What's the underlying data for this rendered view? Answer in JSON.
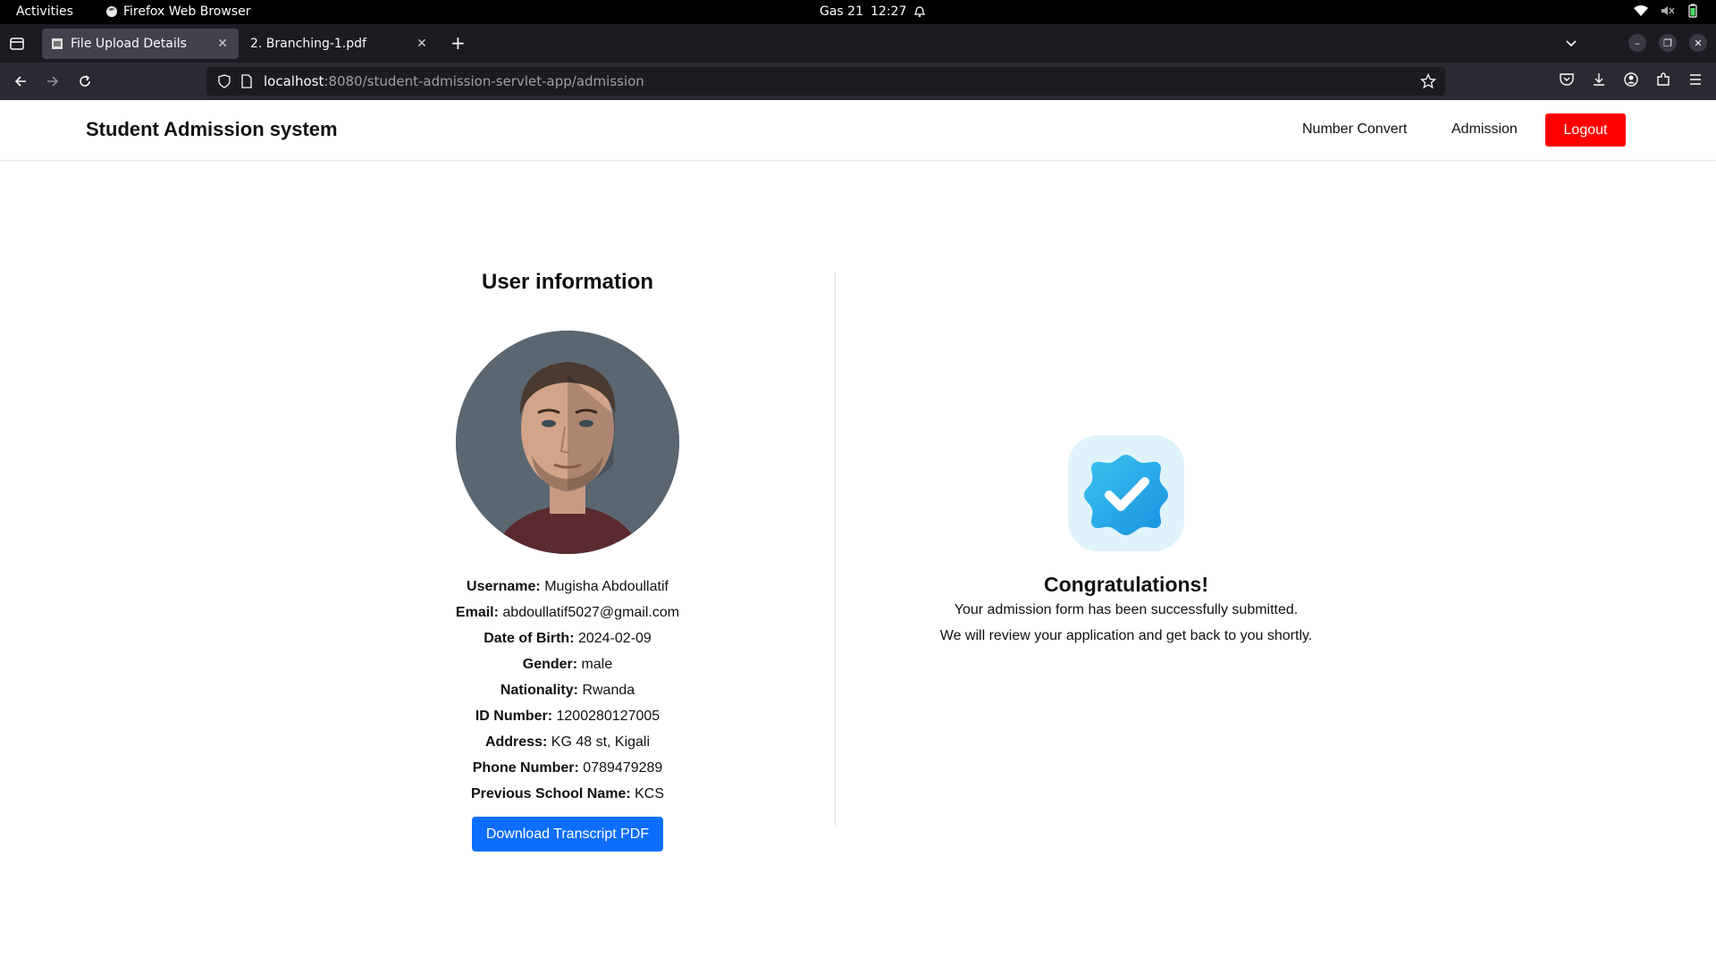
{
  "os_topbar": {
    "activities": "Activities",
    "app_name": "Firefox Web Browser",
    "clock_day": "Gas 21",
    "clock_time": "12:27"
  },
  "browser": {
    "tabs": [
      {
        "label": "File Upload Details",
        "active": true
      },
      {
        "label": "2. Branching-1.pdf",
        "active": false
      }
    ],
    "url_host": "localhost",
    "url_path": ":8080/student-admission-servlet-app/admission"
  },
  "site": {
    "brand": "Student Admission system",
    "nav": {
      "number_convert": "Number Convert",
      "admission": "Admission",
      "logout": "Logout"
    },
    "logout_color": "#ff0000"
  },
  "user_info": {
    "title": "User information",
    "fields": [
      {
        "label": "Username:",
        "value": "Mugisha Abdoullatif"
      },
      {
        "label": "Email:",
        "value": "abdoullatif5027@gmail.com"
      },
      {
        "label": "Date of Birth:",
        "value": "2024-02-09"
      },
      {
        "label": "Gender:",
        "value": "male"
      },
      {
        "label": "Nationality:",
        "value": "Rwanda"
      },
      {
        "label": "ID Number:",
        "value": "1200280127005"
      },
      {
        "label": "Address:",
        "value": "KG 48 st, Kigali"
      },
      {
        "label": "Phone Number:",
        "value": "0789479289"
      },
      {
        "label": "Previous School Name:",
        "value": "KCS"
      }
    ],
    "download_button": "Download Transcript PDF",
    "button_color": "#0d6efd"
  },
  "confirmation": {
    "title": "Congratulations!",
    "line1": "Your admission form has been successfully submitted.",
    "line2": "We will review your application and get back to you shortly.",
    "icon": "verified-badge-icon"
  }
}
